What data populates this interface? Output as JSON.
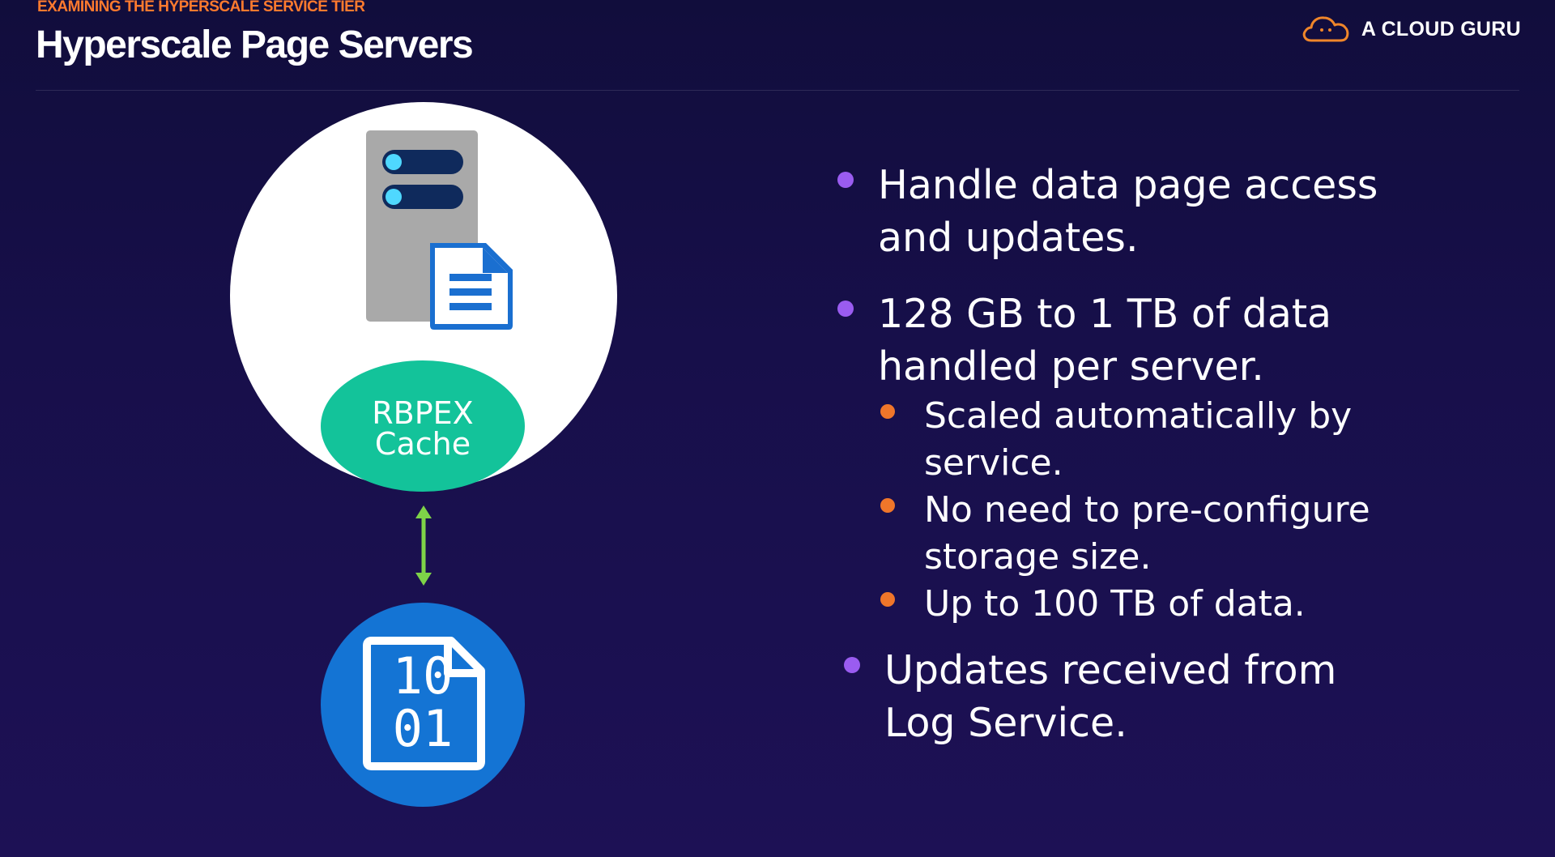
{
  "header": {
    "kicker": "EXAMINING THE HYPERSCALE SERVICE TIER",
    "title": "Hyperscale Page Servers",
    "brand_name": "A CLOUD GURU"
  },
  "diagram": {
    "cache_label_line1": "RBPEX",
    "cache_label_line2": "Cache",
    "data_file_line1": "10",
    "data_file_line2": "01"
  },
  "bullets": [
    {
      "text_line1": "Handle data page access",
      "text_line2": "and updates."
    },
    {
      "text_line1": "128 GB to 1 TB of data",
      "text_line2": "handled per server.",
      "sub": [
        {
          "text_line1": "Scaled automatically by",
          "text_line2": "service."
        },
        {
          "text_line1": "No need to pre-configure",
          "text_line2": "storage size."
        },
        {
          "text_line1": "Up to 100 TB of data."
        }
      ]
    },
    {
      "text_line1": "Updates received from",
      "text_line2": "Log Service."
    }
  ],
  "colors": {
    "accent_orange": "#ff7a2e",
    "bullet_purple": "#9a5cf0",
    "bullet_orange": "#f0762a",
    "cache_green": "#13c39a",
    "arrow_green": "#7ed348",
    "storage_blue": "#1474d4"
  },
  "icons": {
    "brand": "cloud-logo-icon",
    "server": "server-icon",
    "document": "document-icon",
    "arrow": "bidirectional-arrow-icon",
    "data_file": "binary-file-icon"
  }
}
